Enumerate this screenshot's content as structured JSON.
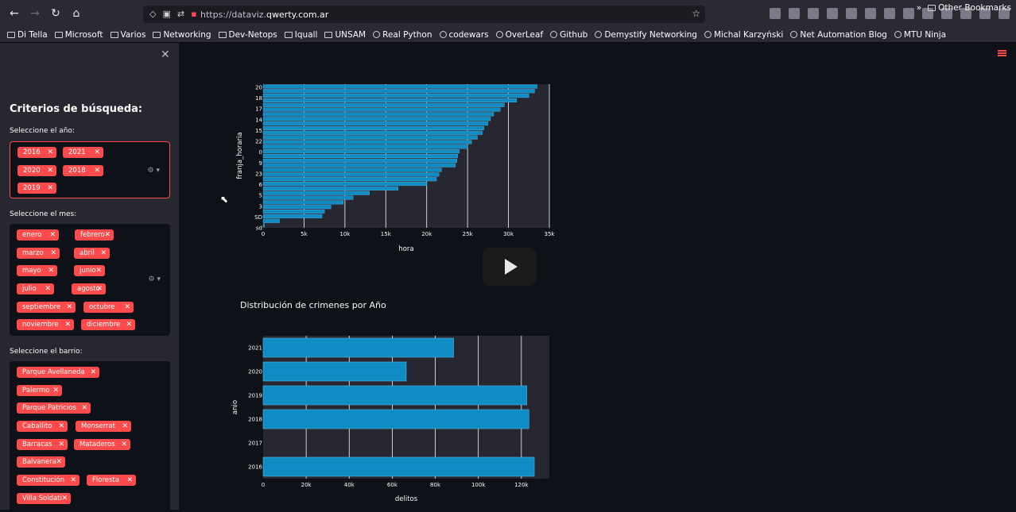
{
  "browser": {
    "url_prefix": "https://dataviz.",
    "url_domain": "qwerty.com.ar",
    "bookmarks": [
      "Di Tella",
      "Microsoft",
      "Varios",
      "Networking",
      "Dev-Netops",
      "Iquall",
      "UNSAM",
      "Real Python",
      "codewars",
      "OverLeaf",
      "Github",
      "Demystify Networking",
      "Michal Karzyński",
      "Net Automation Blog",
      "MTU Ninja"
    ],
    "other_bookmarks": "Other Bookmarks"
  },
  "sidebar": {
    "title": "Criterios de búsqueda:",
    "year_label": "Seleccione el año:",
    "years": [
      "2016",
      "2021",
      "2020",
      "2018",
      "2019"
    ],
    "month_label": "Seleccione el mes:",
    "months": [
      "enero",
      "febrero",
      "marzo",
      "abril",
      "mayo",
      "junio",
      "julio",
      "agosto",
      "septiembre",
      "octubre",
      "noviembre",
      "diciembre"
    ],
    "barrio_label": "Seleccione el barrio:",
    "barrios": [
      "Parque Avellaneda",
      "Palermo",
      "Parque Patricios",
      "Caballito",
      "Monserrat",
      "Barracas",
      "Mataderos",
      "Balvanera",
      "Constitución",
      "Floresta",
      "Villa Soldati"
    ]
  },
  "chart_data": [
    {
      "type": "bar",
      "orientation": "horizontal",
      "title": "",
      "xlabel": "hora",
      "ylabel": "franja_horaria",
      "xlim": [
        0,
        35000
      ],
      "x_ticks": [
        "0",
        "5k",
        "10k",
        "15k",
        "20k",
        "25k",
        "30k",
        "35k"
      ],
      "y_tick_labels": [
        "20",
        "18",
        "17",
        "14",
        "15",
        "22",
        "0",
        "9",
        "23",
        "6",
        "5",
        "3",
        "SD",
        "sd"
      ],
      "values": [
        33500,
        33200,
        32500,
        31000,
        29500,
        29000,
        28200,
        27800,
        27500,
        27000,
        26800,
        26200,
        25500,
        25000,
        24000,
        23800,
        23700,
        23500,
        21800,
        21500,
        21200,
        20000,
        16500,
        13000,
        11000,
        9800,
        8300,
        7500,
        7200,
        2000,
        150
      ]
    },
    {
      "type": "bar",
      "orientation": "horizontal",
      "title": "Distribución de crimenes por Año",
      "xlabel": "delitos",
      "ylabel": "anio",
      "xlim": [
        0,
        133000
      ],
      "x_ticks": [
        "0",
        "20k",
        "40k",
        "60k",
        "80k",
        "100k",
        "120k"
      ],
      "categories": [
        "2021",
        "2020",
        "2019",
        "2018",
        "2017",
        "2016"
      ],
      "values": [
        88500,
        66500,
        122500,
        123500,
        0,
        126000
      ]
    }
  ]
}
